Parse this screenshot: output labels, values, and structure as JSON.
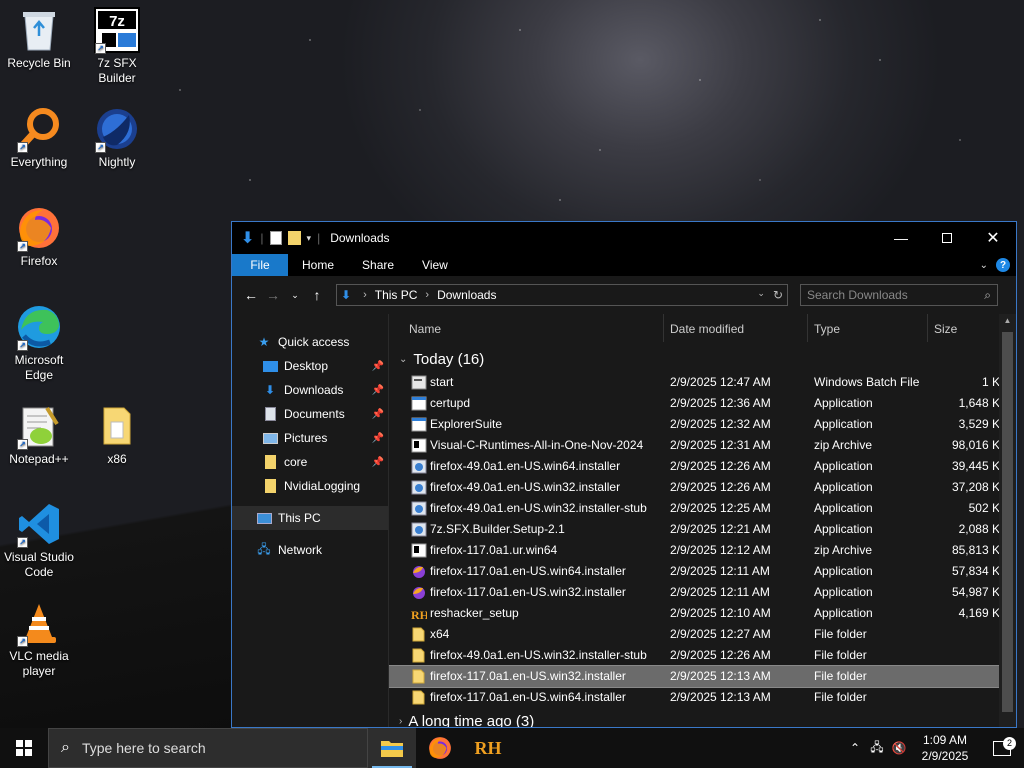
{
  "desktop": {
    "icons": [
      {
        "label": "Recycle Bin"
      },
      {
        "label": "7z SFX Builder"
      },
      {
        "label": "Everything"
      },
      {
        "label": "Nightly"
      },
      {
        "label": "Firefox"
      },
      {
        "label": "Microsoft Edge"
      },
      {
        "label": "Notepad++"
      },
      {
        "label": "x86"
      },
      {
        "label": "Visual Studio Code"
      },
      {
        "label": "VLC media player"
      }
    ]
  },
  "window": {
    "title": "Downloads",
    "ribbon_tabs": [
      "File",
      "Home",
      "Share",
      "View"
    ],
    "address": {
      "segments": [
        "This PC",
        "Downloads"
      ]
    },
    "search_placeholder": "Search Downloads",
    "nav_pane": [
      {
        "label": "Quick access",
        "icon": "star-icon",
        "pinned": false
      },
      {
        "label": "Desktop",
        "icon": "desktop-icon",
        "pinned": true
      },
      {
        "label": "Downloads",
        "icon": "download-arrow-icon",
        "pinned": true
      },
      {
        "label": "Documents",
        "icon": "documents-icon",
        "pinned": true
      },
      {
        "label": "Pictures",
        "icon": "pictures-icon",
        "pinned": true
      },
      {
        "label": "core",
        "icon": "folder-icon",
        "pinned": true
      },
      {
        "label": "NvidiaLogging",
        "icon": "folder-icon",
        "pinned": false
      },
      {
        "label": "This PC",
        "icon": "computer-icon",
        "pinned": false
      },
      {
        "label": "Network",
        "icon": "network-icon",
        "pinned": false
      }
    ],
    "columns": {
      "name": "Name",
      "date": "Date modified",
      "type": "Type",
      "size": "Size"
    },
    "groups": [
      {
        "title": "Today (16)",
        "files": [
          {
            "name": "start",
            "date": "2/9/2025 12:47 AM",
            "type": "Windows Batch File",
            "size": "1 KB",
            "icon": "batch-file-icon"
          },
          {
            "name": "certupd",
            "date": "2/9/2025 12:36 AM",
            "type": "Application",
            "size": "1,648 KB",
            "icon": "application-icon"
          },
          {
            "name": "ExplorerSuite",
            "date": "2/9/2025 12:32 AM",
            "type": "Application",
            "size": "3,529 KB",
            "icon": "application-icon"
          },
          {
            "name": "Visual-C-Runtimes-All-in-One-Nov-2024",
            "date": "2/9/2025 12:31 AM",
            "type": "zip Archive",
            "size": "98,016 KB",
            "icon": "zip-archive-icon"
          },
          {
            "name": "firefox-49.0a1.en-US.win64.installer",
            "date": "2/9/2025 12:26 AM",
            "type": "Application",
            "size": "39,445 KB",
            "icon": "installer-icon"
          },
          {
            "name": "firefox-49.0a1.en-US.win32.installer",
            "date": "2/9/2025 12:26 AM",
            "type": "Application",
            "size": "37,208 KB",
            "icon": "installer-icon"
          },
          {
            "name": "firefox-49.0a1.en-US.win32.installer-stub",
            "date": "2/9/2025 12:25 AM",
            "type": "Application",
            "size": "502 KB",
            "icon": "installer-icon"
          },
          {
            "name": "7z.SFX.Builder.Setup-2.1",
            "date": "2/9/2025 12:21 AM",
            "type": "Application",
            "size": "2,088 KB",
            "icon": "installer-icon"
          },
          {
            "name": "firefox-117.0a1.ur.win64",
            "date": "2/9/2025 12:12 AM",
            "type": "zip Archive",
            "size": "85,813 KB",
            "icon": "zip-archive-icon"
          },
          {
            "name": "firefox-117.0a1.en-US.win64.installer",
            "date": "2/9/2025 12:11 AM",
            "type": "Application",
            "size": "57,834 KB",
            "icon": "firefox-nightly-icon"
          },
          {
            "name": "firefox-117.0a1.en-US.win32.installer",
            "date": "2/9/2025 12:11 AM",
            "type": "Application",
            "size": "54,987 KB",
            "icon": "firefox-nightly-icon"
          },
          {
            "name": "reshacker_setup",
            "date": "2/9/2025 12:10 AM",
            "type": "Application",
            "size": "4,169 KB",
            "icon": "reshacker-icon"
          },
          {
            "name": "x64",
            "date": "2/9/2025 12:27 AM",
            "type": "File folder",
            "size": "",
            "icon": "folder-icon"
          },
          {
            "name": "firefox-49.0a1.en-US.win32.installer-stub",
            "date": "2/9/2025 12:26 AM",
            "type": "File folder",
            "size": "",
            "icon": "folder-icon"
          },
          {
            "name": "firefox-117.0a1.en-US.win32.installer",
            "date": "2/9/2025 12:13 AM",
            "type": "File folder",
            "size": "",
            "icon": "folder-icon",
            "selected": true
          },
          {
            "name": "firefox-117.0a1.en-US.win64.installer",
            "date": "2/9/2025 12:13 AM",
            "type": "File folder",
            "size": "",
            "icon": "folder-icon"
          }
        ]
      },
      {
        "title": "A long time ago (3)",
        "files": []
      }
    ]
  },
  "taskbar": {
    "search_placeholder": "Type here to search",
    "clock_time": "1:09 AM",
    "clock_date": "2/9/2025",
    "notification_count": "2",
    "reshacker_label": "RH"
  },
  "colors": {
    "accent": "#1979ca",
    "selection": "#6b6b6b",
    "folder": "#f3d36b"
  }
}
